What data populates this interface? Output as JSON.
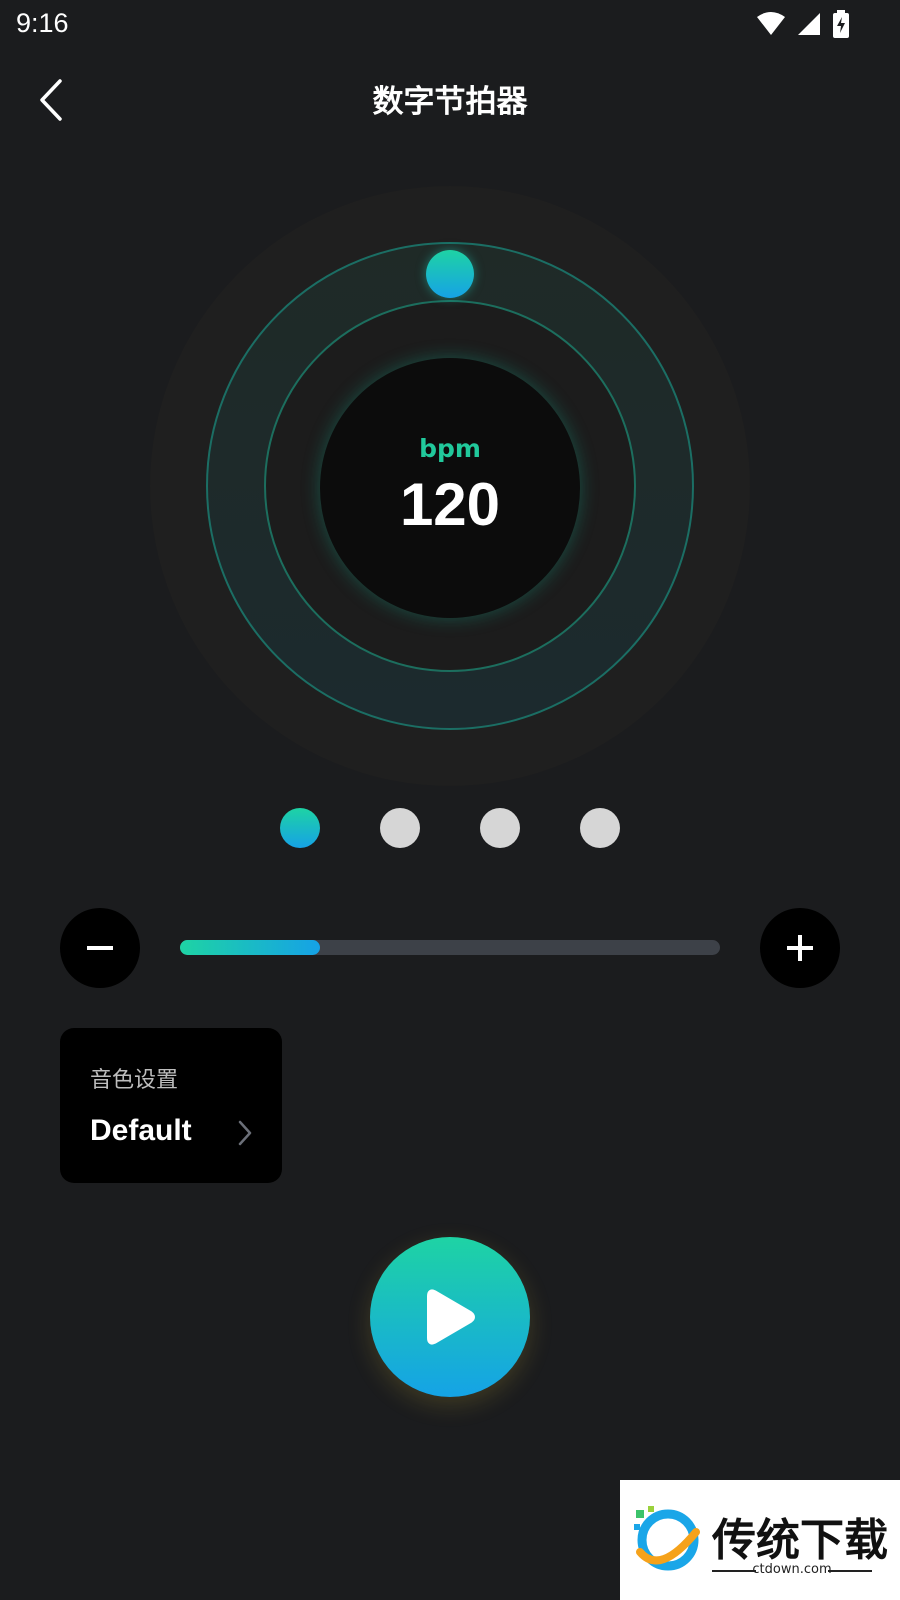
{
  "status_bar": {
    "time": "9:16",
    "icons": [
      "wifi-icon",
      "signal-icon",
      "battery-charging-icon"
    ]
  },
  "header": {
    "title": "数字节拍器",
    "back_icon": "chevron-left-icon"
  },
  "metronome": {
    "unit": "bpm",
    "bpm": "120"
  },
  "beats": {
    "count": 4,
    "active_index": 0
  },
  "tempo": {
    "slider_fraction": 0.26,
    "minus_icon": "minus-icon",
    "plus_icon": "plus-icon"
  },
  "sound": {
    "label": "音色设置",
    "value": "Default",
    "chevron_icon": "chevron-right-icon"
  },
  "play": {
    "icon": "play-icon"
  },
  "watermark": {
    "text": "传统下载",
    "sub": "ctdown.com"
  },
  "colors": {
    "accent_start": "#1ed3a4",
    "accent_end": "#16a2e6",
    "background": "#1b1c1e",
    "inactive_dot": "#d6d6d6"
  }
}
